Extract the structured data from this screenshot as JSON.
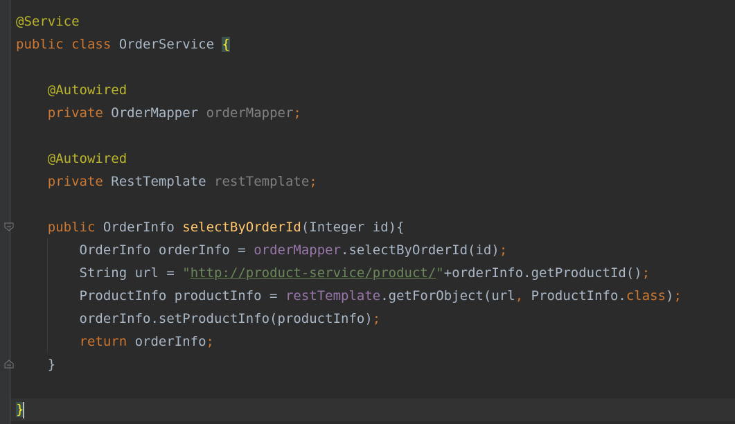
{
  "lines": {
    "l1": {
      "annotation": "@Service"
    },
    "l2": {
      "kw_public": "public",
      "kw_class": "class",
      "class_name": " OrderService ",
      "open_brace": "{"
    },
    "l4": {
      "annotation": "@Autowired"
    },
    "l5": {
      "kw_private": "private",
      "type": " OrderMapper ",
      "field": "orderMapper",
      "semi": ";"
    },
    "l7": {
      "annotation": "@Autowired"
    },
    "l8": {
      "kw_private": "private",
      "type": " RestTemplate ",
      "field": "restTemplate",
      "semi": ";"
    },
    "l10": {
      "kw_public": "public",
      "type": " OrderInfo ",
      "method": "selectByOrderId",
      "params": "(Integer id){"
    },
    "l11": {
      "pre": "OrderInfo orderInfo = ",
      "field": "orderMapper",
      "call": ".selectByOrderId(id)",
      "semi": ";"
    },
    "l12": {
      "pre": "String url = ",
      "q1": "\"",
      "url": "http://product-service/product/",
      "q2": "\"",
      "post": "+orderInfo.getProductId()",
      "semi": ";"
    },
    "l13": {
      "pre": "ProductInfo productInfo = ",
      "field": "restTemplate",
      "call": ".getForObject(url",
      "comma": ",",
      "arg": " ProductInfo.",
      "kw_class": "class",
      "close": ")",
      "semi": ";"
    },
    "l14": {
      "call": "orderInfo.setProductInfo(productInfo)",
      "semi": ";"
    },
    "l15": {
      "kw_return": "return",
      "rest": " orderInfo",
      "semi": ";"
    },
    "l16": {
      "close_brace": "}"
    },
    "l18": {
      "close_brace": "}"
    }
  },
  "colors": {
    "background": "#2b2b2b",
    "keyword": "#cc7832",
    "annotation": "#bbb529",
    "method_decl": "#ffc66d",
    "field": "#9876aa",
    "string": "#6a8759",
    "text": "#a9b7c6"
  },
  "icons": [
    "fold-icon",
    "fold-end-icon"
  ]
}
